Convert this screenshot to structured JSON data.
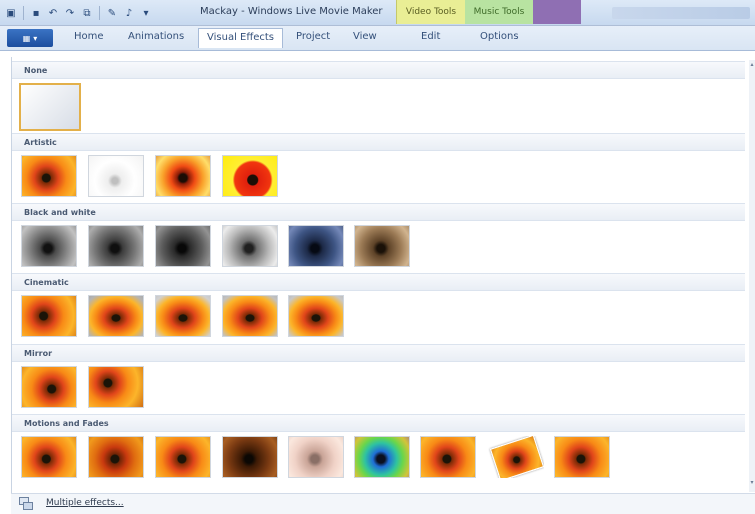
{
  "window": {
    "title": "Mackay - Windows Live Movie Maker",
    "contextual_tabs": [
      "Video Tools",
      "Music Tools"
    ]
  },
  "quick_access": [
    "app-icon",
    "save-icon",
    "undo-icon",
    "redo-icon",
    "clip-icon",
    "add-music-icon",
    "music-icon",
    "dropdown-icon"
  ],
  "ribbon": {
    "tabs": [
      "Home",
      "Animations",
      "Visual Effects",
      "Project",
      "View",
      "Edit",
      "Options"
    ],
    "active_tab": "Visual Effects"
  },
  "gallery": {
    "sections": [
      {
        "label": "None",
        "thumbs": [
          "plain"
        ]
      },
      {
        "label": "Artistic",
        "thumbs": [
          "orange-flower",
          "white-sketch",
          "posterized",
          "red-yellow"
        ]
      },
      {
        "label": "Black and white",
        "thumbs": [
          "gray-1",
          "gray-2",
          "gray-3",
          "gray-4",
          "blue-tone",
          "sepia"
        ]
      },
      {
        "label": "Cinematic",
        "thumbs": [
          "cinema-1",
          "cinema-2",
          "cinema-3",
          "cinema-4",
          "cinema-5"
        ]
      },
      {
        "label": "Mirror",
        "thumbs": [
          "mirror-1",
          "mirror-2"
        ]
      },
      {
        "label": "Motions and Fades",
        "thumbs": [
          "motion-1",
          "motion-2",
          "motion-3",
          "motion-4",
          "motion-5",
          "motion-6",
          "motion-7",
          "motion-8",
          "motion-9"
        ]
      }
    ]
  },
  "footer": {
    "multiple_effects_label": "Multiple effects..."
  },
  "colors": {
    "accent_blue": "#1d4e9e",
    "selection": "#e3b04a",
    "video_tools": "#e9ee95",
    "music_tools": "#b8e3a1"
  }
}
